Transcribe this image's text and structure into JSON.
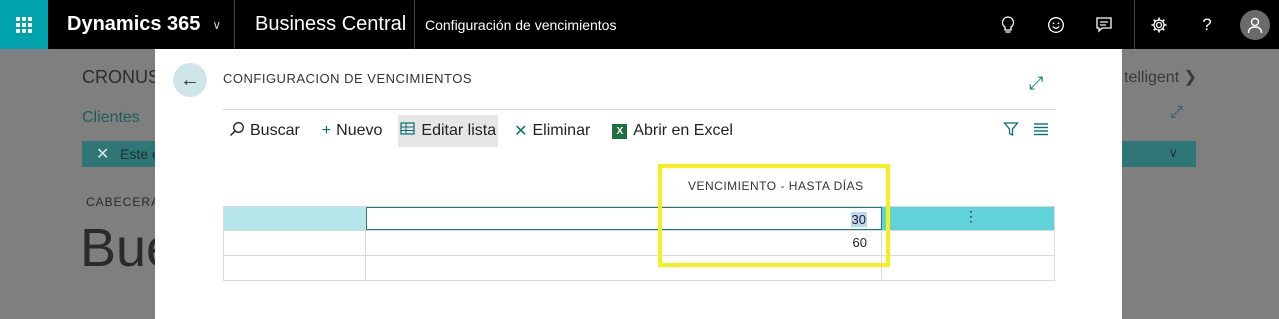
{
  "topbar": {
    "product": "Dynamics 365",
    "app": "Business Central",
    "page": "Configuración de vencimientos",
    "icons": [
      "lightbulb-icon",
      "smiley-icon",
      "chat-icon",
      "gear-icon",
      "help-icon",
      "user-avatar-icon"
    ],
    "help_label": "?"
  },
  "background": {
    "company": "CRONUS",
    "link": "Clientes",
    "filter": "Este e",
    "heading": "CABECERA",
    "big_text": "Bue",
    "right_text": "telligent"
  },
  "dialog": {
    "title": "CONFIGURACION DE VENCIMIENTOS",
    "actions": {
      "search": "Buscar",
      "new": "Nuevo",
      "edit_list": "Editar lista",
      "delete": "Eliminar",
      "excel": "Abrir en Excel"
    },
    "column_header": "VENCIMIENTO - HASTA DÍAS",
    "rows": [
      {
        "value": "30",
        "selected": true
      },
      {
        "value": "60",
        "selected": false
      },
      {
        "value": "",
        "selected": false
      }
    ]
  },
  "colors": {
    "accent": "#00a2ad",
    "highlight": "#f3f01e",
    "selected_row": "#5fd3d9"
  }
}
